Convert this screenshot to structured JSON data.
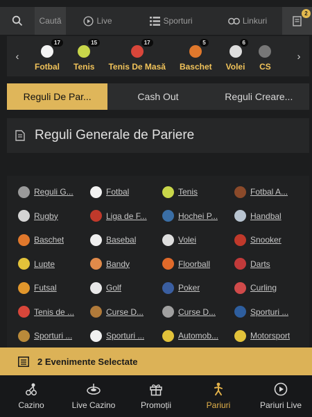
{
  "topnav": {
    "search_label": "Caută",
    "live_label": "Live",
    "sports_label": "Sporturi",
    "links_label": "Linkuri",
    "betslip_count": "2"
  },
  "sports": [
    {
      "label": "Fotbal",
      "count": "17",
      "color": "#f4f4f4"
    },
    {
      "label": "Tenis",
      "count": "15",
      "color": "#c8d64a"
    },
    {
      "label": "Tenis De Masă",
      "count": "17",
      "color": "#d8463a"
    },
    {
      "label": "Baschet",
      "count": "5",
      "color": "#e0782c"
    },
    {
      "label": "Volei",
      "count": "6",
      "color": "#dedede"
    },
    {
      "label": "CS",
      "count": "",
      "color": "#777777"
    }
  ],
  "tabs": [
    "Reguli De Par...",
    "Cash Out",
    "Reguli Creare..."
  ],
  "title": "Reguli Generale de Pariere",
  "rules": [
    {
      "label": "Reguli G...",
      "color": "#9a9a9a"
    },
    {
      "label": "Fotbal",
      "color": "#f2f2f2"
    },
    {
      "label": "Tenis",
      "color": "#c8d64a"
    },
    {
      "label": "Fotbal A...",
      "color": "#8b4a2a"
    },
    {
      "label": "Rugby",
      "color": "#d4d4d4"
    },
    {
      "label": "Liga de F...",
      "color": "#c0392b"
    },
    {
      "label": "Hochei P...",
      "color": "#3a6ea5"
    },
    {
      "label": "Handbal",
      "color": "#b8c4d0"
    },
    {
      "label": "Baschet",
      "color": "#e0782c"
    },
    {
      "label": "Basebal",
      "color": "#efefef"
    },
    {
      "label": "Volei",
      "color": "#dedede"
    },
    {
      "label": "Snooker",
      "color": "#c0392b"
    },
    {
      "label": "Lupte",
      "color": "#e2c23a"
    },
    {
      "label": "Bandy",
      "color": "#e08a4a"
    },
    {
      "label": "Floorball",
      "color": "#e06a2a"
    },
    {
      "label": "Darts",
      "color": "#c23a3a"
    },
    {
      "label": "Futsal",
      "color": "#e0962c"
    },
    {
      "label": "Golf",
      "color": "#e8e8e8"
    },
    {
      "label": "Poker",
      "color": "#3a5ea0"
    },
    {
      "label": "Curling",
      "color": "#d04a4a"
    },
    {
      "label": "Tenis de ...",
      "color": "#d8463a"
    },
    {
      "label": "Curse D...",
      "color": "#b07a3a"
    },
    {
      "label": "Curse D...",
      "color": "#a0a0a0"
    },
    {
      "label": "Sporturi ...",
      "color": "#2e5e9e"
    },
    {
      "label": "Sporturi ...",
      "color": "#b98a3a"
    },
    {
      "label": "Sporturi ...",
      "color": "#f0f0f0"
    },
    {
      "label": "Automob...",
      "color": "#e2c23a"
    },
    {
      "label": "Motorsport",
      "color": "#e2c23a"
    }
  ],
  "betslip_label": "2 Evenimente Selectate",
  "bottomnav": [
    {
      "label": "Cazino",
      "icon": "dice-icon"
    },
    {
      "label": "Live Cazino",
      "icon": "roulette-icon"
    },
    {
      "label": "Promoții",
      "icon": "gift-icon"
    },
    {
      "label": "Pariuri",
      "icon": "player-icon"
    },
    {
      "label": "Pariuri Live",
      "icon": "play-circle-icon"
    }
  ],
  "colors": {
    "accent": "#dfb65a",
    "background": "#1c1d1e"
  }
}
